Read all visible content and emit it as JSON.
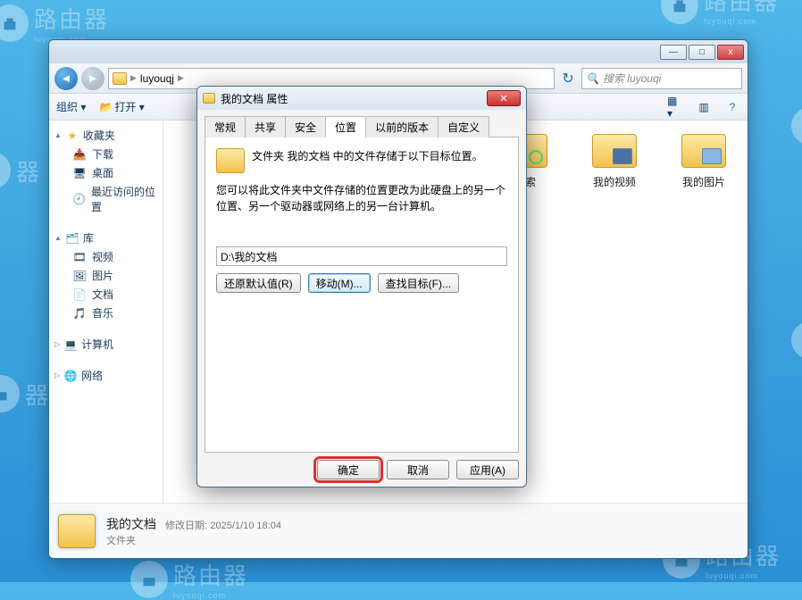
{
  "wallpaper": {
    "brand": "路由器",
    "sub": "luyouqi.com"
  },
  "explorer": {
    "address_segments": [
      "luyouqj"
    ],
    "search_placeholder": "搜索 luyouqi",
    "toolbar": {
      "organize": "组织",
      "open": "打开"
    },
    "nav": {
      "favorites": {
        "label": "收藏夹",
        "items": [
          "下载",
          "桌面",
          "最近访问的位置"
        ]
      },
      "libraries": {
        "label": "库",
        "items": [
          "视频",
          "图片",
          "文档",
          "音乐"
        ]
      },
      "computer": {
        "label": "计算机"
      },
      "network": {
        "label": "网络"
      }
    },
    "content_items": [
      "搜索",
      "我的视频",
      "我的图片"
    ],
    "details": {
      "name": "我的文档",
      "date_label": "修改日期:",
      "date_value": "2025/1/10 18:04",
      "type": "文件夹"
    }
  },
  "dialog": {
    "title": "我的文档 属性",
    "tabs": [
      "常规",
      "共享",
      "安全",
      "位置",
      "以前的版本",
      "自定义"
    ],
    "active_tab_index": 3,
    "location": {
      "line1": "文件夹 我的文档 中的文件存储于以下目标位置。",
      "line2": "您可以将此文件夹中文件存储的位置更改为此硬盘上的另一个位置、另一个驱动器或网络上的另一台计算机。",
      "path": "D:\\我的文档",
      "buttons": {
        "restore": "还原默认值(R)",
        "move": "移动(M)...",
        "find": "查找目标(F)..."
      }
    },
    "actions": {
      "ok": "确定",
      "cancel": "取消",
      "apply": "应用(A)"
    }
  }
}
